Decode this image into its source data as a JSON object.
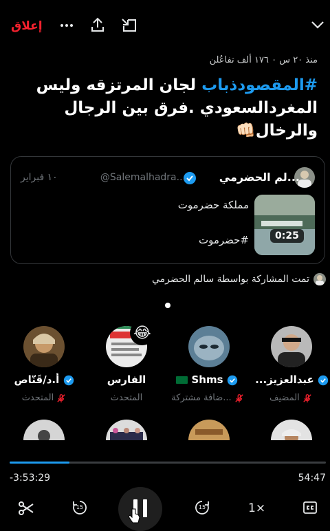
{
  "header": {
    "close_label": "إعلاق",
    "more_icon": "more-dots-icon",
    "share_icon": "share-upload-icon",
    "minimize_icon": "minimize-icon",
    "collapse_icon": "chevron-down-icon"
  },
  "space": {
    "meta": "منذ ٢٠ س ٠ ١٧٦ ألف تفاعُلن",
    "title_hashtag": "#المقصودذباب",
    "title_rest": " لجان المرتزقه وليس المغردالسعودي .فرق بين الرجال والرخال👊🏻"
  },
  "shared_card": {
    "author_name": "...لم الحضرمي",
    "handle": "@Salemalhadra...",
    "date": "١٠ فبراير",
    "text_line1": "مملكة حضرموت",
    "text_line2": "#حضرموت",
    "video_duration": "0:25"
  },
  "shared_by": "تمت المشاركة بواسطة سالم الحضرمي",
  "participants": [
    {
      "name": "عبدالعزيز...",
      "role": "المضيف",
      "verified": true,
      "muted": true
    },
    {
      "name": "Shms",
      "role": "...ضافة مشتركة",
      "verified": true,
      "muted": true,
      "flag": "🇸🇦"
    },
    {
      "name": "الفارس",
      "role": "المتحدث",
      "verified": false,
      "muted": false,
      "reaction": "😂"
    },
    {
      "name": "أ.د/قَنّاص",
      "role": "المتحدث",
      "verified": true,
      "muted": true
    }
  ],
  "player": {
    "elapsed": "54:47",
    "remaining": "-3:53:29",
    "progress": 0.19,
    "speed_label": "1×",
    "rewind_label": "15",
    "forward_label": "15"
  },
  "colors": {
    "accent": "#1d9bf0",
    "close": "#f4212e",
    "muted": "#f4212e",
    "background": "#000000"
  }
}
